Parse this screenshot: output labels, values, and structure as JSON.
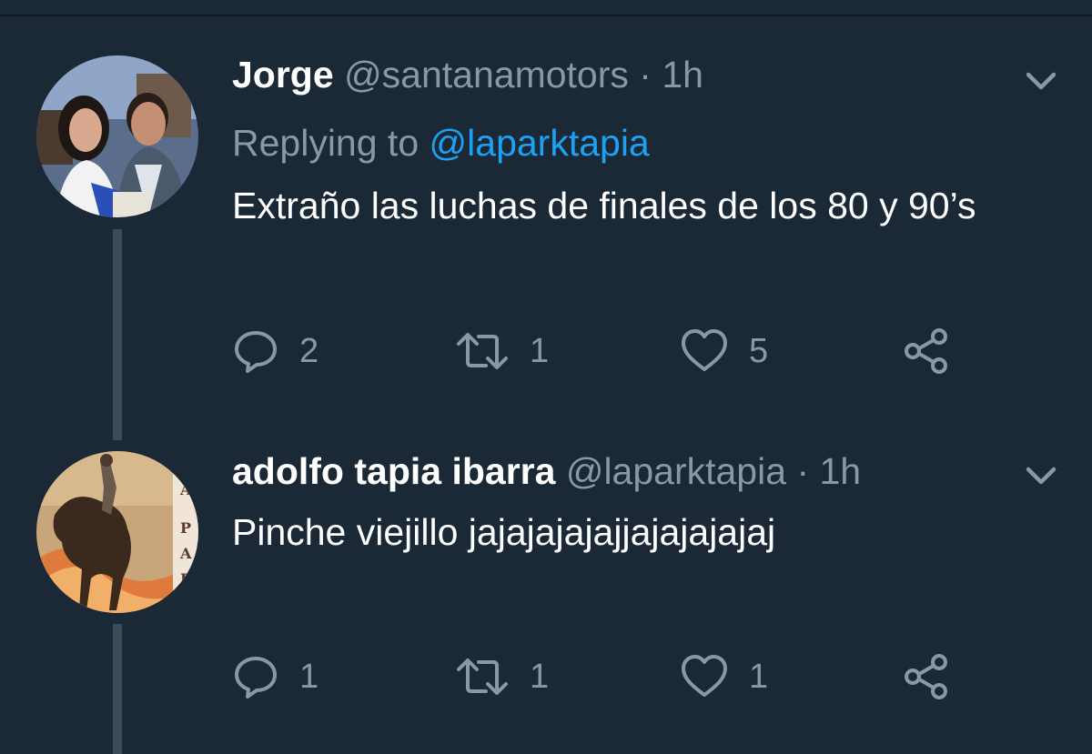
{
  "colors": {
    "background": "#1b2836",
    "muted": "#8899a6",
    "link": "#1da1f2",
    "thread_line": "#3a4b5c"
  },
  "tweets": [
    {
      "name": "Jorge",
      "handle": "@santanamotors",
      "separator": "·",
      "time": "1h",
      "replying_prefix": "Replying to",
      "replying_to": "@laparktapia",
      "text": "Extraño las luchas de finales de los 80 y 90’s",
      "avatar_icon": "profile-photo-two-people",
      "menu_icon": "chevron-down-icon",
      "actions": {
        "reply_icon": "reply-icon",
        "reply_count": "2",
        "retweet_icon": "retweet-icon",
        "retweet_count": "1",
        "like_icon": "heart-icon",
        "like_count": "5",
        "share_icon": "share-icon"
      }
    },
    {
      "name": "adolfo tapia ibarra",
      "handle": "@laparktapia",
      "separator": "·",
      "time": "1h",
      "text": "Pinche viejillo jajajajajajjajajajajaj",
      "avatar_icon": "profile-image-horse-rider-poster",
      "avatar_letters": [
        "A",
        "P",
        "A",
        "R"
      ],
      "menu_icon": "chevron-down-icon",
      "actions": {
        "reply_icon": "reply-icon",
        "reply_count": "1",
        "retweet_icon": "retweet-icon",
        "retweet_count": "1",
        "like_icon": "heart-icon",
        "like_count": "1",
        "share_icon": "share-icon"
      }
    }
  ]
}
